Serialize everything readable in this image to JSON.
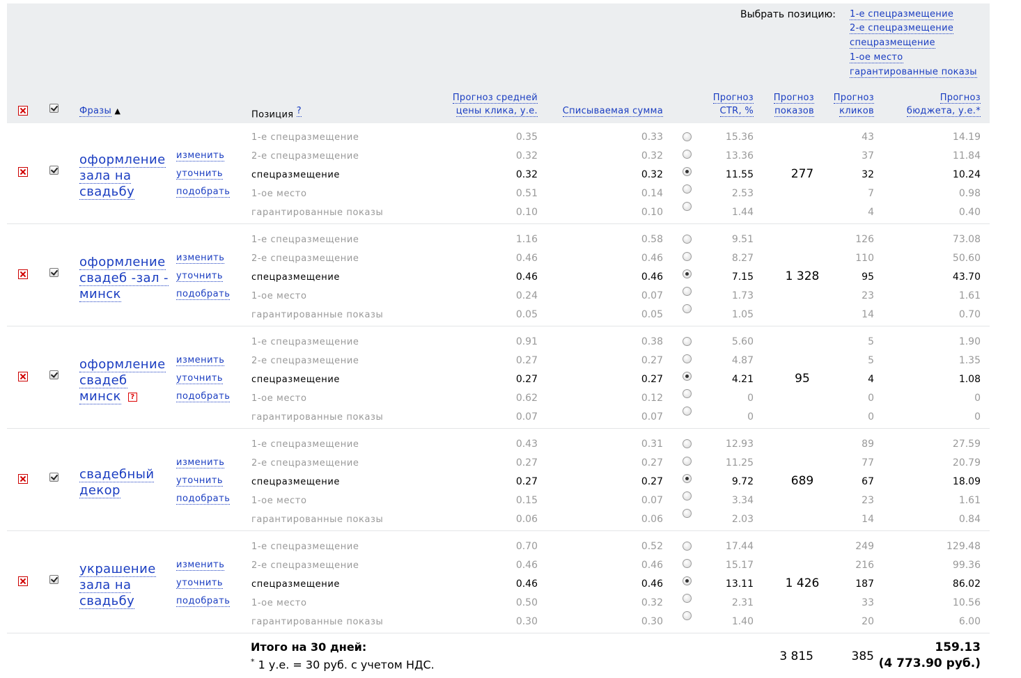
{
  "choose_position": {
    "label": "Выбрать позицию:",
    "options": [
      "1-е спецразмещение",
      "2-е спецразмещение",
      "спецразмещение",
      "1-ое место",
      "гарантированные показы"
    ]
  },
  "headers": {
    "phrases": "Фразы",
    "sort_arrow": "▲",
    "position": "Позиция",
    "position_help": "?",
    "avg_price_1": "Прогноз средней",
    "avg_price_2": "цены клика, у.е.",
    "charged": "Списываемая сумма",
    "ctr_1": "Прогноз",
    "ctr_2": "CTR, %",
    "shows_1": "Прогноз",
    "shows_2": "показов",
    "clicks_1": "Прогноз",
    "clicks_2": "кликов",
    "budget_1": "Прогноз",
    "budget_2": "бюджета, у.е.*"
  },
  "actions": {
    "edit": "изменить",
    "refine": "уточнить",
    "pick": "подобрать"
  },
  "groups": [
    {
      "phrase": [
        "оформление",
        "зала на",
        "свадьбу"
      ],
      "warning": false,
      "shows": "277",
      "rows": [
        {
          "position": "1-е спецразмещение",
          "price": "0.35",
          "charge": "0.33",
          "ctr": "15.36",
          "clicks": "43",
          "budget": "14.19",
          "selected": false
        },
        {
          "position": "2-е спецразмещение",
          "price": "0.32",
          "charge": "0.32",
          "ctr": "13.36",
          "clicks": "37",
          "budget": "11.84",
          "selected": false
        },
        {
          "position": "спецразмещение",
          "price": "0.32",
          "charge": "0.32",
          "ctr": "11.55",
          "clicks": "32",
          "budget": "10.24",
          "selected": true
        },
        {
          "position": "1-ое место",
          "price": "0.51",
          "charge": "0.14",
          "ctr": "2.53",
          "clicks": "7",
          "budget": "0.98",
          "selected": false
        },
        {
          "position": "гарантированные показы",
          "price": "0.10",
          "charge": "0.10",
          "ctr": "1.44",
          "clicks": "4",
          "budget": "0.40",
          "selected": false
        }
      ]
    },
    {
      "phrase": [
        "оформление",
        "свадеб -зал -",
        "минск"
      ],
      "warning": false,
      "shows": "1 328",
      "rows": [
        {
          "position": "1-е спецразмещение",
          "price": "1.16",
          "charge": "0.58",
          "ctr": "9.51",
          "clicks": "126",
          "budget": "73.08",
          "selected": false
        },
        {
          "position": "2-е спецразмещение",
          "price": "0.46",
          "charge": "0.46",
          "ctr": "8.27",
          "clicks": "110",
          "budget": "50.60",
          "selected": false
        },
        {
          "position": "спецразмещение",
          "price": "0.46",
          "charge": "0.46",
          "ctr": "7.15",
          "clicks": "95",
          "budget": "43.70",
          "selected": true
        },
        {
          "position": "1-ое место",
          "price": "0.24",
          "charge": "0.07",
          "ctr": "1.73",
          "clicks": "23",
          "budget": "1.61",
          "selected": false
        },
        {
          "position": "гарантированные показы",
          "price": "0.05",
          "charge": "0.05",
          "ctr": "1.05",
          "clicks": "14",
          "budget": "0.70",
          "selected": false
        }
      ]
    },
    {
      "phrase": [
        "оформление",
        "свадеб",
        "минск"
      ],
      "warning": true,
      "warning_glyph": "?",
      "shows": "95",
      "rows": [
        {
          "position": "1-е спецразмещение",
          "price": "0.91",
          "charge": "0.38",
          "ctr": "5.60",
          "clicks": "5",
          "budget": "1.90",
          "selected": false
        },
        {
          "position": "2-е спецразмещение",
          "price": "0.27",
          "charge": "0.27",
          "ctr": "4.87",
          "clicks": "5",
          "budget": "1.35",
          "selected": false
        },
        {
          "position": "спецразмещение",
          "price": "0.27",
          "charge": "0.27",
          "ctr": "4.21",
          "clicks": "4",
          "budget": "1.08",
          "selected": true
        },
        {
          "position": "1-ое место",
          "price": "0.62",
          "charge": "0.12",
          "ctr": "0",
          "clicks": "0",
          "budget": "0",
          "selected": false
        },
        {
          "position": "гарантированные показы",
          "price": "0.07",
          "charge": "0.07",
          "ctr": "0",
          "clicks": "0",
          "budget": "0",
          "selected": false
        }
      ]
    },
    {
      "phrase": [
        "свадебный",
        "декор"
      ],
      "warning": false,
      "shows": "689",
      "rows": [
        {
          "position": "1-е спецразмещение",
          "price": "0.43",
          "charge": "0.31",
          "ctr": "12.93",
          "clicks": "89",
          "budget": "27.59",
          "selected": false
        },
        {
          "position": "2-е спецразмещение",
          "price": "0.27",
          "charge": "0.27",
          "ctr": "11.25",
          "clicks": "77",
          "budget": "20.79",
          "selected": false
        },
        {
          "position": "спецразмещение",
          "price": "0.27",
          "charge": "0.27",
          "ctr": "9.72",
          "clicks": "67",
          "budget": "18.09",
          "selected": true
        },
        {
          "position": "1-ое место",
          "price": "0.15",
          "charge": "0.07",
          "ctr": "3.34",
          "clicks": "23",
          "budget": "1.61",
          "selected": false
        },
        {
          "position": "гарантированные показы",
          "price": "0.06",
          "charge": "0.06",
          "ctr": "2.03",
          "clicks": "14",
          "budget": "0.84",
          "selected": false
        }
      ]
    },
    {
      "phrase": [
        "украшение",
        "зала на",
        "свадьбу"
      ],
      "warning": false,
      "shows": "1 426",
      "rows": [
        {
          "position": "1-е спецразмещение",
          "price": "0.70",
          "charge": "0.52",
          "ctr": "17.44",
          "clicks": "249",
          "budget": "129.48",
          "selected": false
        },
        {
          "position": "2-е спецразмещение",
          "price": "0.46",
          "charge": "0.46",
          "ctr": "15.17",
          "clicks": "216",
          "budget": "99.36",
          "selected": false
        },
        {
          "position": "спецразмещение",
          "price": "0.46",
          "charge": "0.46",
          "ctr": "13.11",
          "clicks": "187",
          "budget": "86.02",
          "selected": true
        },
        {
          "position": "1-ое место",
          "price": "0.50",
          "charge": "0.32",
          "ctr": "2.31",
          "clicks": "33",
          "budget": "10.56",
          "selected": false
        },
        {
          "position": "гарантированные показы",
          "price": "0.30",
          "charge": "0.30",
          "ctr": "1.40",
          "clicks": "20",
          "budget": "6.00",
          "selected": false
        }
      ]
    }
  ],
  "totals": {
    "title": "Итого на 30 дней:",
    "note_star": "*",
    "note": " 1 у.е. = 30 руб. с учетом НДС.",
    "shows": "3 815",
    "clicks": "385",
    "budget": "159.13",
    "budget_rub": "(4 773.90 руб.)"
  },
  "colors": {
    "link": "#1a3dc1",
    "header_bg": "#eceef0",
    "delete_red": "#d00000",
    "muted_text": "#999999"
  }
}
